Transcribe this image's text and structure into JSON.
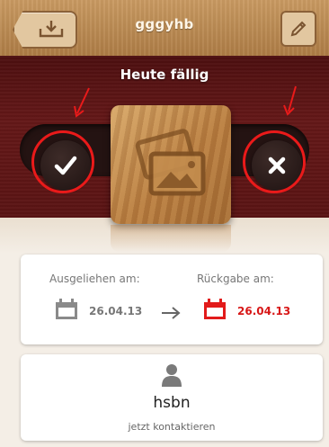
{
  "header": {
    "title": "gggyhb"
  },
  "status": {
    "due_label": "Heute fällig"
  },
  "loan": {
    "lent_label": "Ausgeliehen am:",
    "lent_date": "26.04.13",
    "return_label": "Rückgabe am:",
    "return_date": "26.04.13"
  },
  "contact": {
    "name": "hsbn",
    "action": "jetzt kontaktieren"
  },
  "colors": {
    "wood": "#b98447",
    "banner": "#5a1414",
    "accent_red": "#ea1a1a",
    "due_red": "#d81818"
  },
  "icons": {
    "back": "download-tray-icon",
    "edit": "pencil-icon",
    "confirm": "checkmark-icon",
    "reject": "x-icon",
    "photo": "picture-icon",
    "calendar": "calendar-icon",
    "person": "person-icon"
  }
}
